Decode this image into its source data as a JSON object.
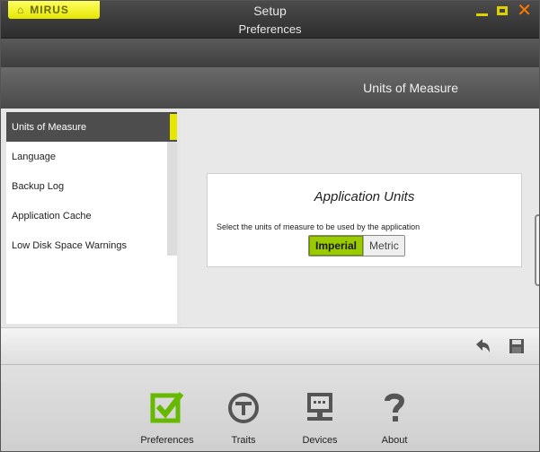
{
  "window": {
    "brand": "MIRUS",
    "title": "Setup",
    "subtitle": "Preferences"
  },
  "section": {
    "title": "Units of Measure"
  },
  "nav": {
    "items": [
      {
        "label": "Units of Measure"
      },
      {
        "label": "Language"
      },
      {
        "label": "Backup Log"
      },
      {
        "label": "Application Cache"
      },
      {
        "label": "Low Disk Space Warnings"
      }
    ]
  },
  "units_card": {
    "title": "Application Units",
    "description": "Select the units of measure to be used by the application",
    "options": [
      "Imperial",
      "Metric"
    ],
    "selected": "Imperial"
  },
  "dock": {
    "items": [
      {
        "label": "Preferences",
        "icon": "preferences-check-icon"
      },
      {
        "label": "Traits",
        "icon": "traits-t-icon"
      },
      {
        "label": "Devices",
        "icon": "devices-monitor-icon"
      },
      {
        "label": "About",
        "icon": "about-question-icon"
      }
    ]
  },
  "colors": {
    "accent_yellow": "#e6e600",
    "selected_green": "#9acb00",
    "close_orange": "#ff7a00",
    "icon_green": "#66b800",
    "icon_gray": "#555555"
  }
}
